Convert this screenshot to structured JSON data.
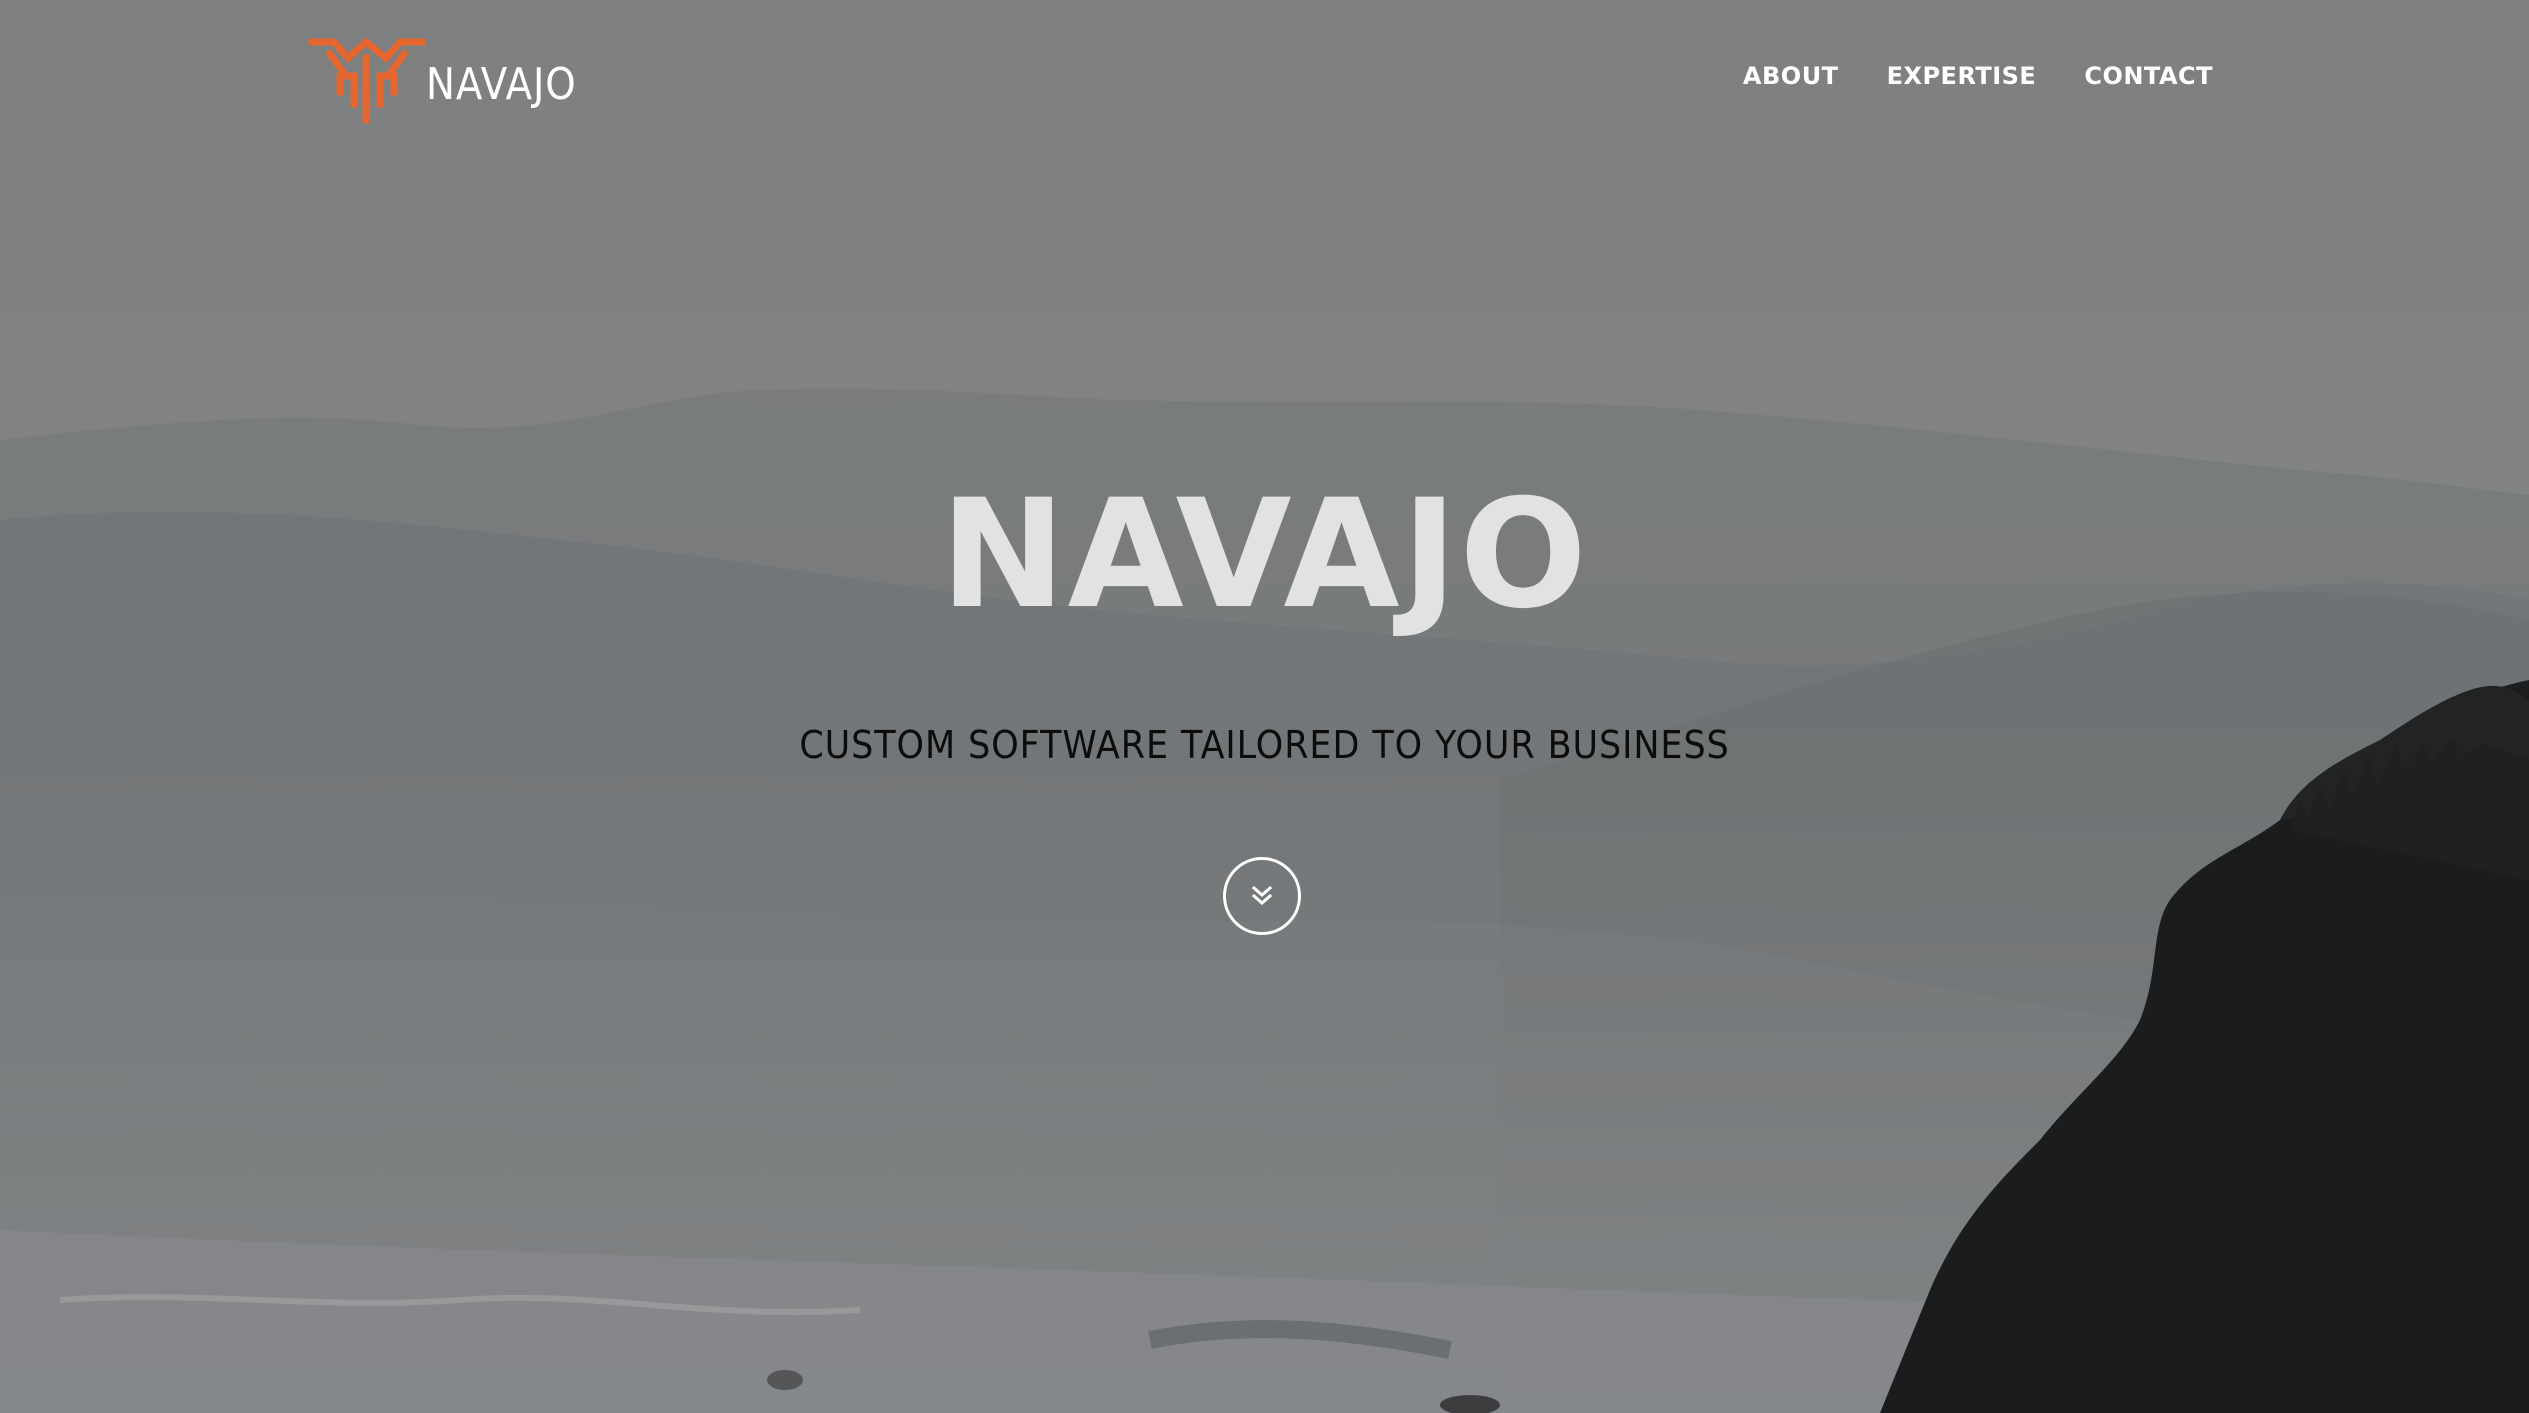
{
  "brand": {
    "name": "NAVAJO",
    "logo_icon": "navajo-emblem-icon",
    "accent_color": "#e5662e"
  },
  "nav": {
    "items": [
      {
        "label": "ABOUT"
      },
      {
        "label": "EXPERTISE"
      },
      {
        "label": "CONTACT"
      }
    ]
  },
  "hero": {
    "title": "NAVAJO",
    "tagline": "CUSTOM SOFTWARE TAILORED TO YOUR BUSINESS",
    "scroll_icon": "double-chevron-down-icon",
    "background": "foggy-coastal-mountains-photo"
  }
}
